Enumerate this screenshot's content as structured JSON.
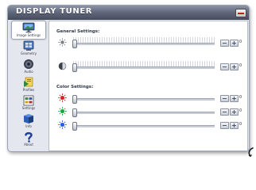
{
  "app": {
    "title": "DISPLAY TUNER"
  },
  "sidebar": {
    "items": [
      {
        "label": "Image Settings",
        "icon": "monitor-icon",
        "active": true
      },
      {
        "label": "Geometry",
        "icon": "geometry-icon",
        "active": false
      },
      {
        "label": "Audio",
        "icon": "speaker-icon",
        "active": false
      },
      {
        "label": "Profiles",
        "icon": "profiles-icon",
        "active": false
      },
      {
        "label": "Settings",
        "icon": "settings-icon",
        "active": false
      },
      {
        "label": "Info",
        "icon": "info-icon",
        "active": false
      },
      {
        "label": "About",
        "icon": "question-icon",
        "active": false
      }
    ]
  },
  "general": {
    "title": "General Settings:",
    "rows": [
      {
        "icon": "brightness-icon",
        "value": "0",
        "level": 0
      },
      {
        "icon": "contrast-icon",
        "value": "0",
        "level": 0
      }
    ]
  },
  "color": {
    "title": "Color Settings:",
    "rows": [
      {
        "icon": "red-color-icon",
        "value": "0",
        "level": 0,
        "color": "#e02020"
      },
      {
        "icon": "green-color-icon",
        "value": "0",
        "level": 0,
        "color": "#1fa83a"
      },
      {
        "icon": "blue-color-icon",
        "value": "0",
        "level": 0,
        "color": "#2a5ee8"
      }
    ]
  }
}
